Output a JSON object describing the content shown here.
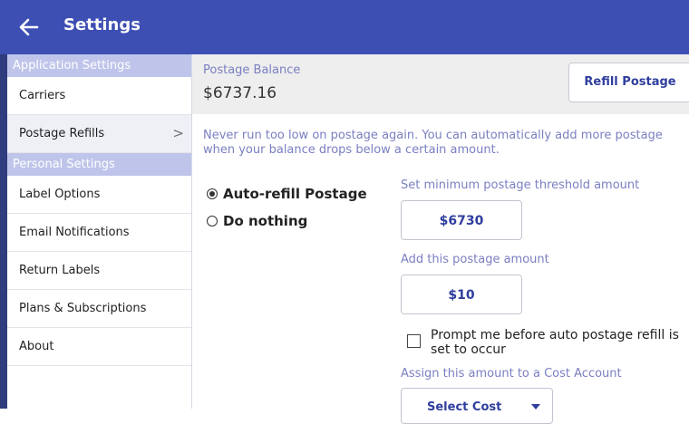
{
  "header": {
    "title": "Settings",
    "back_icon": "arrow-left-icon"
  },
  "sidebar": {
    "sections": [
      {
        "header": "Application Settings",
        "items": [
          {
            "label": "Carriers"
          },
          {
            "label": "Postage Refills",
            "active": true,
            "chevron": ">"
          }
        ]
      },
      {
        "header": "Personal Settings",
        "items": [
          {
            "label": "Label Options"
          },
          {
            "label": "Email Notifications"
          },
          {
            "label": "Return Labels"
          },
          {
            "label": "Plans & Subscriptions"
          },
          {
            "label": "About"
          }
        ]
      }
    ]
  },
  "balance": {
    "label": "Postage Balance",
    "value": "$6737.16",
    "refill_button": "Refill Postage"
  },
  "refill": {
    "info": "Never run too low on postage again. You can automatically add more postage when your balance drops below a certain amount.",
    "options": [
      {
        "label": "Auto-refill Postage",
        "selected": true
      },
      {
        "label": "Do nothing",
        "selected": false
      }
    ],
    "threshold_label": "Set minimum postage threshold amount",
    "threshold_value": "$6730",
    "add_label": "Add this postage amount",
    "add_value": "$10",
    "prompt_label": "Prompt me before auto postage refill is set to occur",
    "prompt_checked": false,
    "cost_account_label": "Assign this amount to a Cost Account",
    "cost_account_select": "Select Cost"
  },
  "colors": {
    "header_bg": "#3d4fb3",
    "section_header_bg": "#bfc5ea",
    "accent_text": "#7a7fc1",
    "button_text": "#2f3e9e"
  }
}
